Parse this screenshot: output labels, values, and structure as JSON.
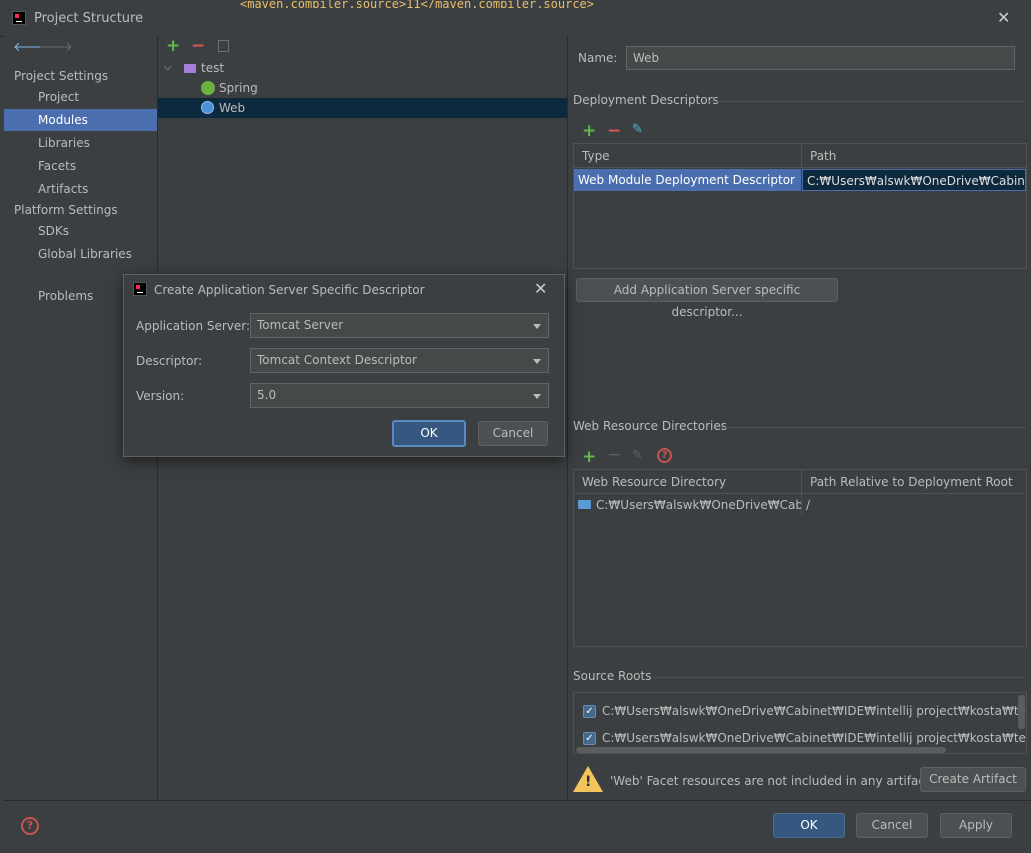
{
  "window": {
    "title": "Project Structure"
  },
  "editor": {
    "line_fragment": "<maven.compiler.source>11</maven.compiler.source>"
  },
  "sidebar": {
    "project_settings_label": "Project Settings",
    "project_settings_items": [
      {
        "label": "Project"
      },
      {
        "label": "Modules"
      },
      {
        "label": "Libraries"
      },
      {
        "label": "Facets"
      },
      {
        "label": "Artifacts"
      }
    ],
    "platform_settings_label": "Platform Settings",
    "platform_settings_items": [
      {
        "label": "SDKs"
      },
      {
        "label": "Global Libraries"
      }
    ],
    "problems_label": "Problems"
  },
  "tree": {
    "root": "test",
    "children": [
      {
        "label": "Spring"
      },
      {
        "label": "Web"
      }
    ]
  },
  "detail": {
    "name_label": "Name:",
    "name_value": "Web",
    "deployment_descriptors_label": "Deployment Descriptors",
    "dd_columns": [
      "Type",
      "Path"
    ],
    "dd_row": {
      "type": "Web Module Deployment Descriptor",
      "path": "C:₩Users₩alswk₩OneDrive₩Cabinet₩IDE"
    },
    "add_server_descriptor_button": "Add Application Server specific descriptor...",
    "web_resource_dirs_label": "Web Resource Directories",
    "wr_columns": [
      "Web Resource Directory",
      "Path Relative to Deployment Root"
    ],
    "wr_row": {
      "dir": "C:₩Users₩alswk₩OneDrive₩Cabine...",
      "relative": "/"
    },
    "source_roots_label": "Source Roots",
    "source_roots": [
      {
        "path": "C:₩Users₩alswk₩OneDrive₩Cabinet₩IDE₩intellij project₩kosta₩test₩src₩main",
        "checked": true
      },
      {
        "path": "C:₩Users₩alswk₩OneDrive₩Cabinet₩IDE₩intellij project₩kosta₩test₩src₩main",
        "checked": true
      }
    ],
    "warning_text": "'Web' Facet resources are not included in any artifacts",
    "create_artifact_button": "Create Artifact"
  },
  "footer": {
    "ok": "OK",
    "cancel": "Cancel",
    "apply": "Apply"
  },
  "dialog": {
    "title": "Create Application Server Specific Descriptor",
    "server_label": "Application Server:",
    "server_value": "Tomcat Server",
    "descriptor_label": "Descriptor:",
    "descriptor_value": "Tomcat Context Descriptor",
    "version_label": "Version:",
    "version_value": "5.0",
    "ok": "OK",
    "cancel": "Cancel"
  },
  "colors": {
    "background": "#3c3f41",
    "selection": "#4b6eaf",
    "tree_selection": "#0d293e",
    "primary_button": "#365880",
    "add": "#5fb84e",
    "remove": "#e05555",
    "warning": "#f2c55c"
  }
}
